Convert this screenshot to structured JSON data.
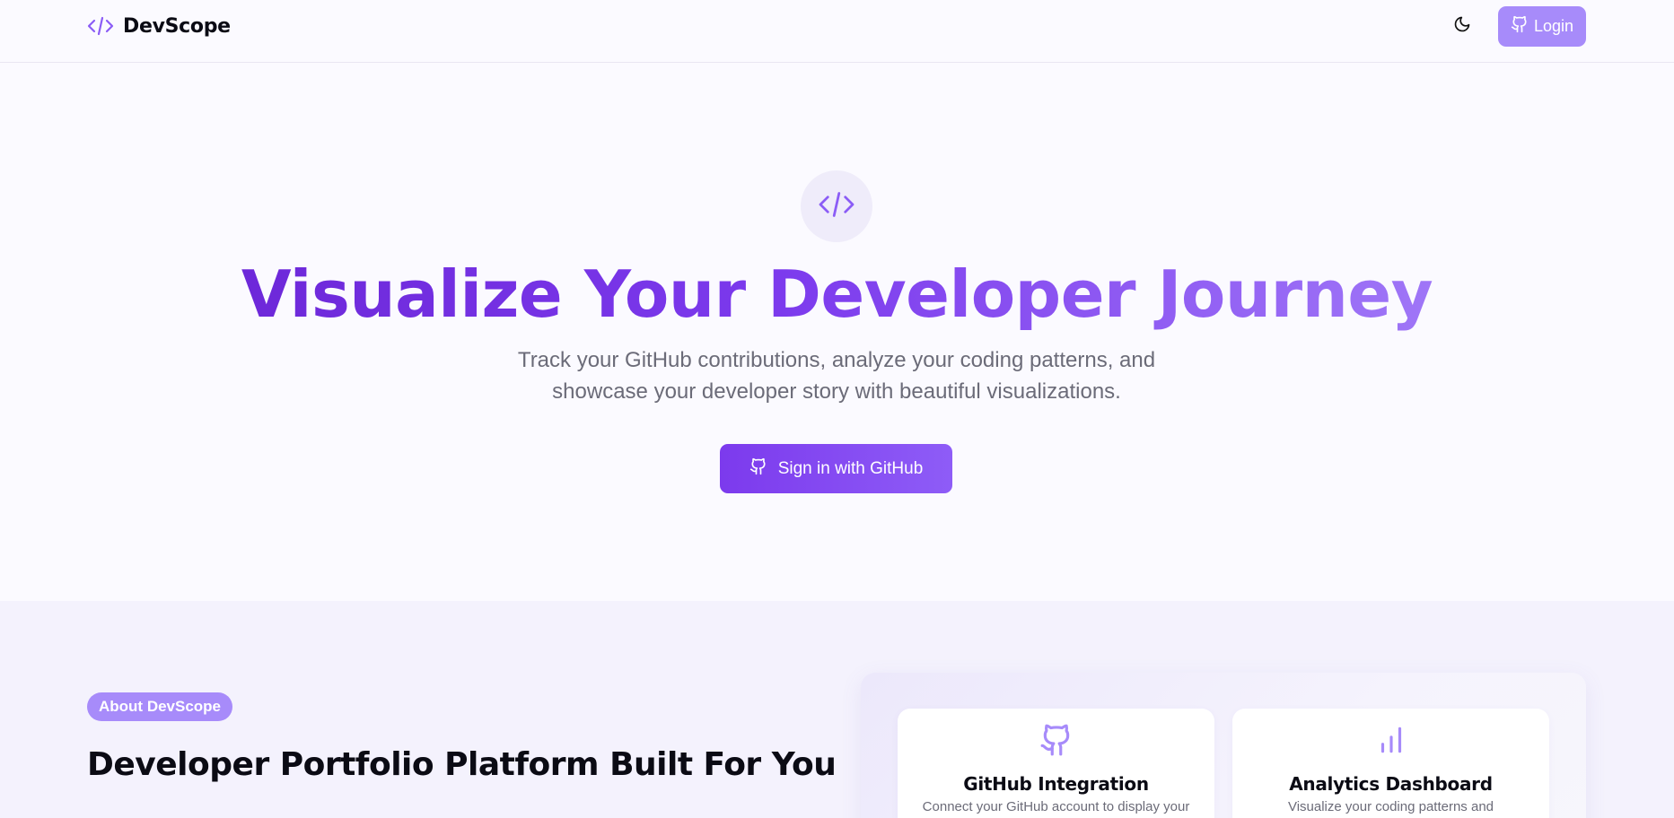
{
  "header": {
    "brand_name": "DevScope",
    "login_label": "Login"
  },
  "hero": {
    "title": "Visualize Your Developer Journey",
    "subtitle": "Track your GitHub contributions, analyze your coding patterns, and showcase your developer story with beautiful visualizations.",
    "cta_label": "Sign in with GitHub"
  },
  "about": {
    "pill": "About DevScope",
    "title": "Developer Portfolio Platform Built For You",
    "features": [
      {
        "icon": "github-icon",
        "title": "GitHub Integration",
        "desc": "Connect your GitHub account to display your"
      },
      {
        "icon": "bar-chart-icon",
        "title": "Analytics Dashboard",
        "desc": "Visualize your coding patterns and"
      }
    ]
  },
  "colors": {
    "accent": "#7c3aed",
    "accent_light": "#a78bfa",
    "background": "#fbfaff",
    "section_background": "#f4f2fd"
  }
}
